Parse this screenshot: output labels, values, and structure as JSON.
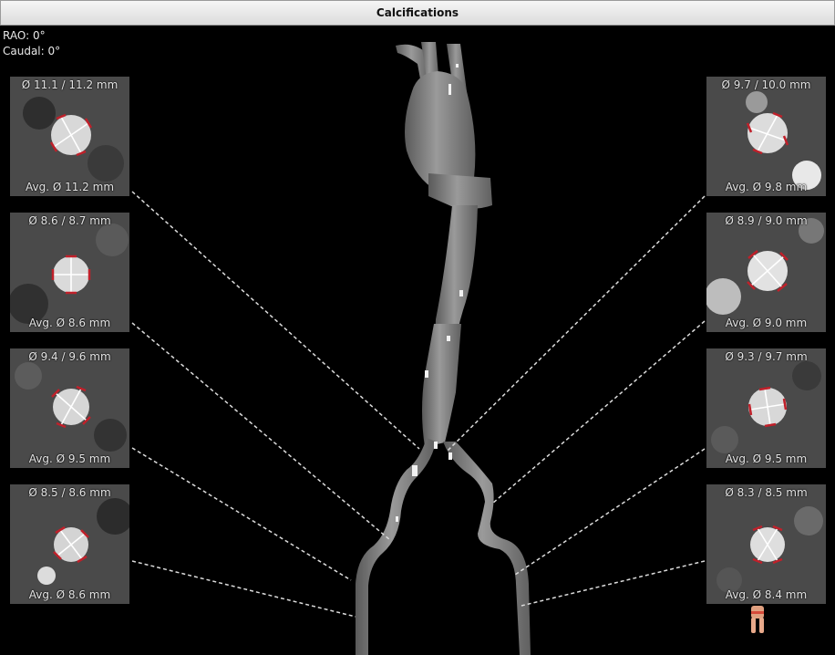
{
  "window": {
    "title": "Calcifications"
  },
  "orientation": {
    "rao": "RAO: 0°",
    "caudal": "Caudal: 0°"
  },
  "panels_left": [
    {
      "top": "Ø 11.1 / 11.2 mm",
      "bottom": "Avg. Ø 11.2 mm"
    },
    {
      "top": "Ø 8.6 / 8.7 mm",
      "bottom": "Avg. Ø 8.6 mm"
    },
    {
      "top": "Ø 9.4 / 9.6 mm",
      "bottom": "Avg. Ø 9.5 mm"
    },
    {
      "top": "Ø 8.5 / 8.6 mm",
      "bottom": "Avg. Ø 8.6 mm"
    }
  ],
  "panels_right": [
    {
      "top": "Ø 9.7 / 10.0 mm",
      "bottom": "Avg. Ø 9.8 mm"
    },
    {
      "top": "Ø 8.9 / 9.0 mm",
      "bottom": "Avg. Ø 9.0 mm"
    },
    {
      "top": "Ø 9.3 / 9.7 mm",
      "bottom": "Avg. Ø 9.5 mm"
    },
    {
      "top": "Ø 8.3 / 8.5 mm",
      "bottom": "Avg. Ø 8.4 mm"
    }
  ],
  "colors": {
    "measure_tick": "#c0202a",
    "leader_line": "#dcdcdc",
    "vessel": "#8a8a8a"
  }
}
